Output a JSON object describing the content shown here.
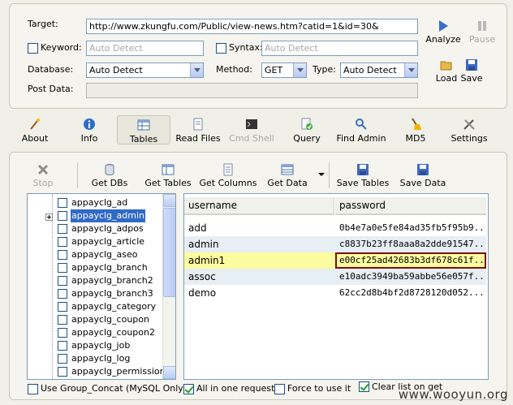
{
  "form": {
    "target_label": "Target:",
    "target_value": "http://www.zkungfu.com/Public/view-news.htm?catid=1&id=30&",
    "keyword_label": "Keyword:",
    "keyword_placeholder": "Auto Detect",
    "syntax_label": "Syntax:",
    "syntax_placeholder": "Auto Detect",
    "database_label": "Database:",
    "database_value": "Auto Detect",
    "method_label": "Method:",
    "method_value": "GET",
    "type_label": "Type:",
    "type_value": "Auto Detect",
    "postdata_label": "Post Data:"
  },
  "actions": {
    "analyze": "Analyze",
    "pause": "Pause",
    "load": "Load",
    "save": "Save"
  },
  "nav": {
    "about": "About",
    "info": "Info",
    "tables": "Tables",
    "read_files": "Read Files",
    "cmd_shell": "Cmd Shell",
    "query": "Query",
    "find_admin": "Find Admin",
    "md5": "MD5",
    "settings": "Settings"
  },
  "toolbar": {
    "stop": "Stop",
    "get_dbs": "Get DBs",
    "get_tables": "Get Tables",
    "get_columns": "Get Columns",
    "get_data": "Get Data",
    "save_tables": "Save Tables",
    "save_data": "Save Data"
  },
  "tree": {
    "items": [
      {
        "label": "appayclg_ad"
      },
      {
        "label": "appayclg_admin"
      },
      {
        "label": "appayclg_adpos"
      },
      {
        "label": "appayclg_article"
      },
      {
        "label": "appayclg_aseo"
      },
      {
        "label": "appayclg_branch"
      },
      {
        "label": "appayclg_branch2"
      },
      {
        "label": "appayclg_branch3"
      },
      {
        "label": "appayclg_category"
      },
      {
        "label": "appayclg_coupon"
      },
      {
        "label": "appayclg_coupon2"
      },
      {
        "label": "appayclg_job"
      },
      {
        "label": "appayclg_log"
      },
      {
        "label": "appayclg_permission"
      }
    ],
    "selected_index": 1
  },
  "grid": {
    "columns": [
      "username",
      "password"
    ],
    "rows": [
      {
        "username": "add",
        "password": "0b4e7a0e5fe84ad35fb5f95b9..."
      },
      {
        "username": "admin",
        "password": "c8837b23ff8aaa8a2dde91547..."
      },
      {
        "username": "admin1",
        "password": "e00cf25ad42683b3df678c61f..."
      },
      {
        "username": "assoc",
        "password": "e10adc3949ba59abbe56e057f..."
      },
      {
        "username": "demo",
        "password": "62cc2d8b4bf2d8728120d052..."
      }
    ],
    "selected_index": 2
  },
  "footer": {
    "group_concat": "Use Group_Concat (MySQL Only)",
    "all_in_one": "All in one request.",
    "force": "Force to use it",
    "clear_list": "Clear list on get"
  },
  "watermark": "www.wooyun.org"
}
